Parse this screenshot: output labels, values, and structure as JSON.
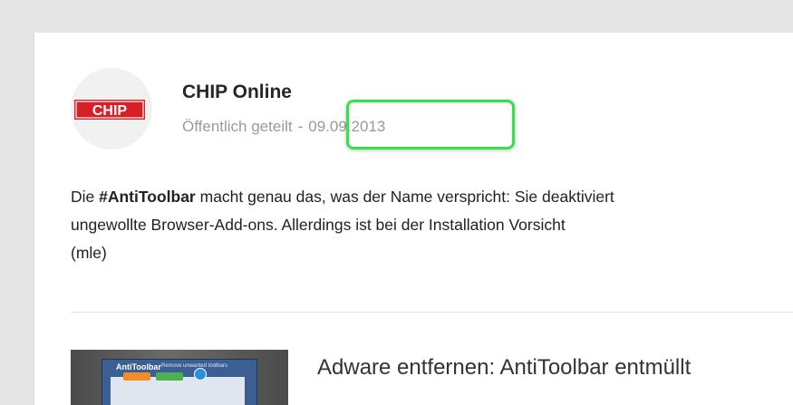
{
  "post": {
    "author": "CHIP Online",
    "visibility": "Öffentlich geteilt",
    "separator": "-",
    "date": "09.09.2013",
    "text_line1_before": "Die ",
    "hashtag": "#AntiToolbar",
    "text_line1_after": " macht genau das, was der Name verspricht: Sie deaktiviert",
    "text_line2": "ungewollte Browser-Add-ons. Allerdings ist bei der Installation Vorsicht",
    "text_line3": "(mle)"
  },
  "avatar": {
    "logo_text": "CHIP",
    "logo_color": "#d91f26"
  },
  "highlight": {
    "color": "#2ee44a"
  },
  "link_preview": {
    "title": "Adware entfernen: AntiToolbar entmüllt",
    "thumbnail_title": "AntiToolbar",
    "thumbnail_subtitle": "Remove unwanted toolbars"
  }
}
